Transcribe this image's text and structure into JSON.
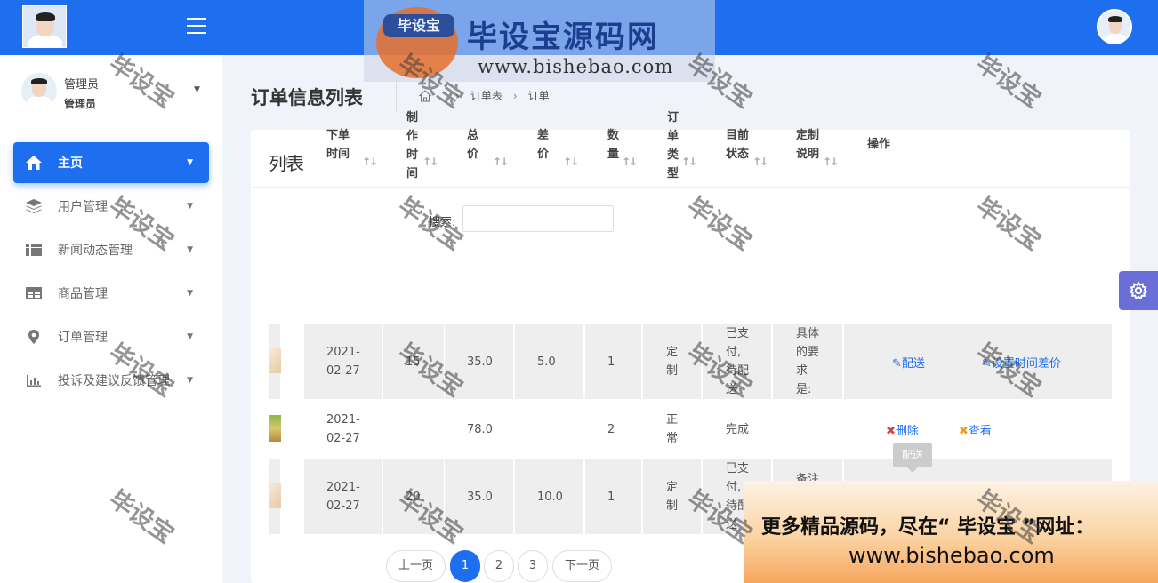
{
  "sidebar": {
    "user": {
      "name": "管理员",
      "role": "管理员"
    },
    "nav": [
      {
        "label": "主页",
        "icon": "home-icon",
        "active": true
      },
      {
        "label": "用户管理",
        "icon": "layers-icon"
      },
      {
        "label": "新闻动态管理",
        "icon": "list-icon"
      },
      {
        "label": "商品管理",
        "icon": "grid-icon"
      },
      {
        "label": "订单管理",
        "icon": "location-pin-icon"
      },
      {
        "label": "投诉及建议反馈管理",
        "icon": "bar-chart-icon"
      }
    ]
  },
  "header": {
    "title": "订单信息列表",
    "breadcrumb": [
      "订单表",
      "订单"
    ]
  },
  "watermark_banner": {
    "title": "毕设宝源码网",
    "tag": "毕设宝",
    "url": "www.bishebao.com"
  },
  "watermark_text": "毕设宝",
  "card": {
    "title": "列表",
    "search_label": "搜索:",
    "search_value": "",
    "table": {
      "columns": [
        "",
        "下单时间",
        "制作时间",
        "总价",
        "差价",
        "数量",
        "订单类型",
        "目前状态",
        "定制说明",
        "操作"
      ],
      "rows": [
        {
          "order_time": "2021-02-27",
          "make_time": "15",
          "total": "35.0",
          "diff": "5.0",
          "qty": "1",
          "type": "定制",
          "status": "已支付,待配送",
          "note": "具体的要求是:",
          "ops": [
            "配送",
            "设置时间差价"
          ]
        },
        {
          "order_time": "2021-02-27",
          "make_time": "",
          "total": "78.0",
          "diff": "",
          "qty": "2",
          "type": "正常",
          "status": "完成",
          "note": "",
          "ops": [
            "删除",
            "查看"
          ]
        },
        {
          "order_time": "2021-02-27",
          "make_time": "20",
          "total": "35.0",
          "diff": "10.0",
          "qty": "1",
          "type": "定制",
          "status": "已支付,待配送",
          "note": "备注",
          "ops": []
        }
      ]
    },
    "tooltip": "配送",
    "pagination": {
      "prev": "上一页",
      "pages": [
        "1",
        "2",
        "3"
      ],
      "current": "1",
      "next": "下一页"
    }
  },
  "promo": {
    "line1": "更多精品源码，尽在“ 毕设宝 ”网址：",
    "line2": "www.bishebao.com"
  },
  "colors": {
    "primary": "#1e6ff0",
    "gear": "#6a6fd8",
    "delete": "#e03c3c",
    "view": "#f0a020"
  }
}
